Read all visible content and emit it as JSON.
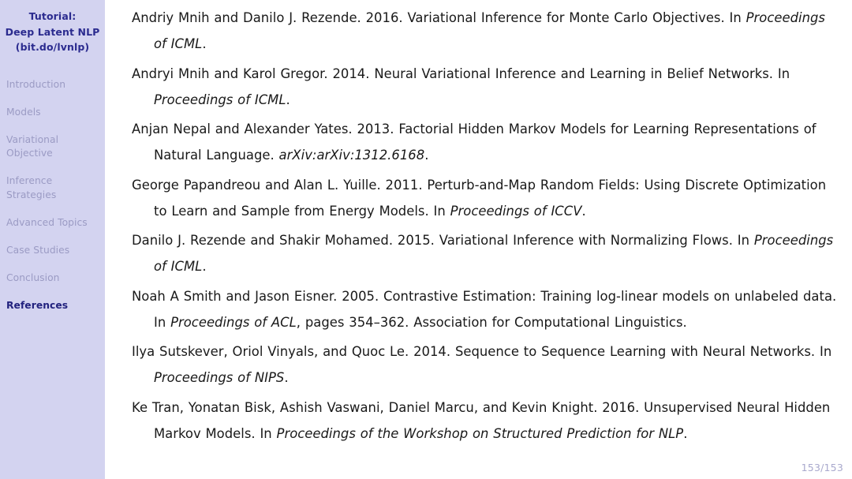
{
  "sidebar": {
    "title_lines": [
      "Tutorial:",
      "Deep Latent NLP",
      "(bit.do/lvnlp)"
    ],
    "items": [
      {
        "label": "Introduction",
        "active": false
      },
      {
        "label": "Models",
        "active": false
      },
      {
        "label": "Variational Objective",
        "active": false
      },
      {
        "label": "Inference Strategies",
        "active": false
      },
      {
        "label": "Advanced Topics",
        "active": false
      },
      {
        "label": "Case Studies",
        "active": false
      },
      {
        "label": "Conclusion",
        "active": false
      },
      {
        "label": "References",
        "active": true
      }
    ]
  },
  "references": [
    {
      "id": "mnih-rezende-2016",
      "parts": [
        {
          "text": "Andriy Mnih and Danilo J. Rezende. 2016. Variational Inference for Monte Carlo Objectives. In ",
          "italic": false
        },
        {
          "text": "Proceedings of ICML",
          "italic": true
        },
        {
          "text": ".",
          "italic": false
        }
      ]
    },
    {
      "id": "mnih-gregor-2014",
      "parts": [
        {
          "text": "Andryi Mnih and Karol Gregor. 2014. Neural Variational Inference and Learning in Belief Networks. In ",
          "italic": false
        },
        {
          "text": "Proceedings of ICML",
          "italic": true
        },
        {
          "text": ".",
          "italic": false
        }
      ]
    },
    {
      "id": "nepal-yates-2013",
      "parts": [
        {
          "text": "Anjan Nepal and Alexander Yates. 2013. Factorial Hidden Markov Models for Learning Representations of Natural Language. ",
          "italic": false
        },
        {
          "text": "arXiv:arXiv:1312.6168",
          "italic": true
        },
        {
          "text": ".",
          "italic": false
        }
      ]
    },
    {
      "id": "papandreou-yuille-2011",
      "parts": [
        {
          "text": "George Papandreou and Alan L. Yuille. 2011. Perturb-and-Map Random Fields: Using Discrete Optimization to Learn and Sample from Energy Models. In ",
          "italic": false
        },
        {
          "text": "Proceedings of ICCV",
          "italic": true
        },
        {
          "text": ".",
          "italic": false
        }
      ]
    },
    {
      "id": "rezende-mohamed-2015",
      "parts": [
        {
          "text": "Danilo J. Rezende and Shakir Mohamed. 2015. Variational Inference with Normalizing Flows. In ",
          "italic": false
        },
        {
          "text": "Proceedings of ICML",
          "italic": true
        },
        {
          "text": ".",
          "italic": false
        }
      ]
    },
    {
      "id": "smith-eisner-2005",
      "parts": [
        {
          "text": "Noah A Smith and Jason Eisner. 2005. Contrastive Estimation: Training log-linear models on unlabeled data. In ",
          "italic": false
        },
        {
          "text": "Proceedings of ACL",
          "italic": true
        },
        {
          "text": ", pages 354–362. Association for Computational Linguistics.",
          "italic": false
        }
      ]
    },
    {
      "id": "sutskever-2014",
      "parts": [
        {
          "text": "Ilya Sutskever, Oriol Vinyals, and Quoc Le. 2014. Sequence to Sequence Learning with Neural Networks. In ",
          "italic": false
        },
        {
          "text": "Proceedings of NIPS",
          "italic": true
        },
        {
          "text": ".",
          "italic": false
        }
      ]
    },
    {
      "id": "tran-2016",
      "parts": [
        {
          "text": "Ke Tran, Yonatan Bisk, Ashish Vaswani, Daniel Marcu, and Kevin Knight. 2016. Unsupervised Neural Hidden Markov Models. In ",
          "italic": false
        },
        {
          "text": "Proceedings of the Workshop on Structured Prediction for NLP",
          "italic": true
        },
        {
          "text": ".",
          "italic": false
        }
      ]
    }
  ],
  "footer": {
    "page_number": "153/153"
  },
  "colors": {
    "sidebar_background": "#d3d3f0",
    "sidebar_title": "#2b2b8f",
    "sidebar_item_inactive": "#9b9bc4",
    "sidebar_item_active": "#22227e",
    "body_text": "#191919",
    "page_number": "#a9a9cd"
  }
}
